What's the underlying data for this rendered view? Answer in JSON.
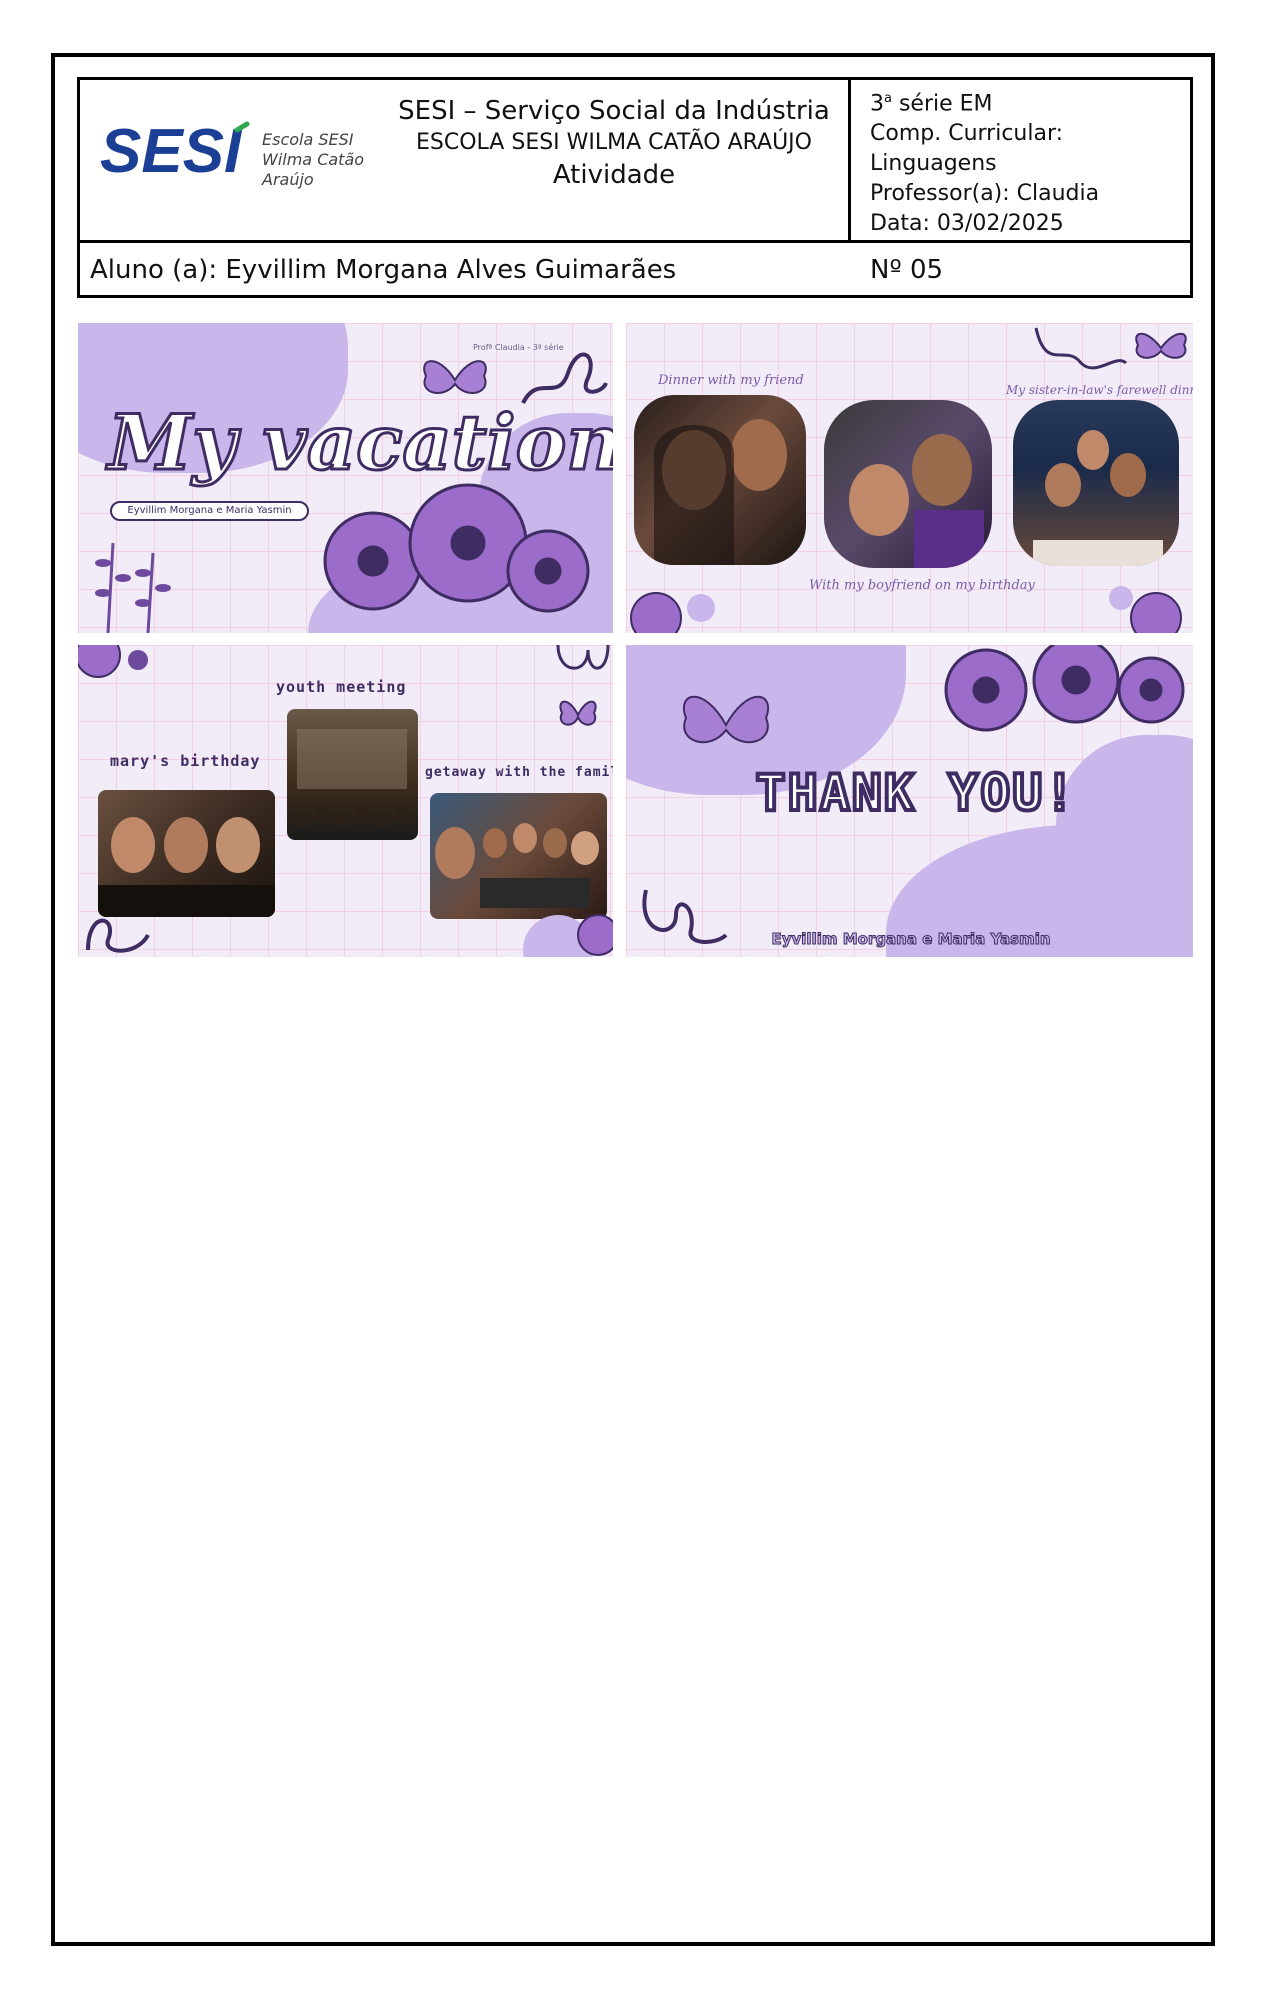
{
  "header": {
    "logo_word": "SESI",
    "logo_sub": [
      "Escola SESI",
      "Wilma Catão",
      "Araújo"
    ],
    "org_line": "SESI – Serviço Social da Indústria",
    "school_line": "ESCOLA SESI WILMA CATÃO ARAÚJO",
    "doc_type": "Atividade",
    "grade_num": "3",
    "grade_sup": "a",
    "grade_rest": " série EM",
    "comp_label": "Comp. Curricular:",
    "comp_value": "Linguagens",
    "teacher": "Professor(a): Claudia",
    "date": "Data: 03/02/2025",
    "student": "Aluno (a): Eyvillim Morgana Alves Guimarães",
    "number": "Nº 05"
  },
  "slides": {
    "s1": {
      "credit": "Profª Claudia - 3ª série",
      "title": "My vacation",
      "authors": "Eyvillim Morgana e Maria Yasmin"
    },
    "s2": {
      "cap1": "Dinner with my friend",
      "cap2": "My sister-in-law's farewell dinner",
      "cap3": "With my boyfriend on my birthday"
    },
    "s3": {
      "cap1": "youth meeting",
      "cap2": "mary's birthday",
      "cap3": "getaway with the family"
    },
    "s4": {
      "title": "THANK YOU!",
      "authors": "Eyvillim Morgana e Maria Yasmin"
    }
  },
  "colors": {
    "purple_dark": "#3e2c63",
    "lavender": "#c9b6ea",
    "bg": "#f1ecf7",
    "logo_blue": "#1b3f94"
  }
}
